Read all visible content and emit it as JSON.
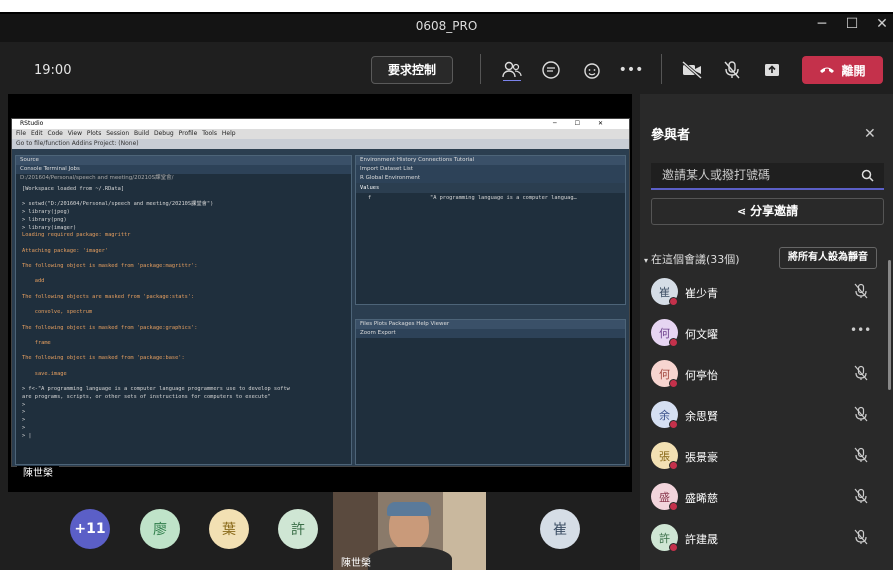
{
  "window": {
    "title": "0608_PRO"
  },
  "toolbar": {
    "time": "19:00",
    "request_control": "要求控制",
    "leave": "離開"
  },
  "share": {
    "sharer_name": "陳世榮"
  },
  "rstudio": {
    "title": "RStudio",
    "menu": "File Edit Code View Plots Session Build Debug Profile Tools Help",
    "toolbar": "Go to file/function   Addins   Project: (None)",
    "source_tab": "Source",
    "console_tabs": "Console  Terminal  Jobs",
    "path": "D:/201604/Personal/speech and meeting/20210S課堂會/",
    "console_lines": [
      "[Workspace loaded from ~/.RData]",
      "",
      "> setwd(\"D:/201604/Personal/speech and meeting/20210S課堂會\")",
      "> library(jpeg)",
      "> library(png)",
      "> library(imager)",
      "Loading required package: magrittr",
      "",
      "Attaching package: 'imager'",
      "",
      "The following object is masked from 'package:magrittr':",
      "",
      "    add",
      "",
      "The following objects are masked from 'package:stats':",
      "",
      "    convolve, spectrum",
      "",
      "The following object is masked from 'package:graphics':",
      "",
      "    frame",
      "",
      "The following object is masked from 'package:base':",
      "",
      "    save.image",
      "",
      "> f<-\"A programming language is a computer language programmers use to develop softw",
      "are programs, scripts, or other sets of instructions for computers to execute\"",
      ">",
      ">",
      ">",
      ">",
      "> |"
    ],
    "env_tabs": "Environment  History  Connections  Tutorial",
    "env_tool": "Import Dataset   List",
    "env_scope": "R   Global Environment",
    "env_section": "Values",
    "env_var": "f",
    "env_value": "\"A programming language is a computer languag…",
    "files_tabs": "Files  Plots  Packages  Help  Viewer",
    "files_tool": "Zoom   Export"
  },
  "gallery": [
    {
      "label": "+11",
      "color": "#5b5fc7",
      "text_color": "#ffffff"
    },
    {
      "label": "廖",
      "color": "#bfe3c9",
      "text_color": "#2e7d4a"
    },
    {
      "label": "葉",
      "color": "#f2e0b3",
      "text_color": "#8a6a1a"
    },
    {
      "label": "許",
      "color": "#cfe6d4",
      "text_color": "#3a6e48"
    },
    {
      "label": "崔",
      "color": "#d5dde6",
      "text_color": "#3b4d63"
    }
  ],
  "video": {
    "label": "陳世榮"
  },
  "panel": {
    "title": "參與者",
    "search_placeholder": "邀請某人或撥打號碼",
    "share_invite": "分享邀請",
    "section": "在這個會議(33個)",
    "mute_all": "將所有人設為靜音",
    "participants": [
      {
        "initial": "崔",
        "name": "崔少青",
        "color": "#d5dde6",
        "text": "#3b4d63",
        "action": "mic-off"
      },
      {
        "initial": "何",
        "name": "何文曜",
        "color": "#e6d5f2",
        "text": "#6b3d8a",
        "action": "more"
      },
      {
        "initial": "何",
        "name": "何亭怡",
        "color": "#f7d5d0",
        "text": "#a0433a",
        "action": "mic-off"
      },
      {
        "initial": "余",
        "name": "余思賢",
        "color": "#d5dff2",
        "text": "#3a528a",
        "action": "mic-off"
      },
      {
        "initial": "張",
        "name": "張景豪",
        "color": "#f2e0b3",
        "text": "#8a6a1a",
        "action": "mic-off"
      },
      {
        "initial": "盛",
        "name": "盛晞慈",
        "color": "#f2d5dc",
        "text": "#8a3a4f",
        "action": "mic-off"
      },
      {
        "initial": "許",
        "name": "許建晟",
        "color": "#cfe6d4",
        "text": "#3a6e48",
        "action": "mic-off"
      }
    ]
  }
}
